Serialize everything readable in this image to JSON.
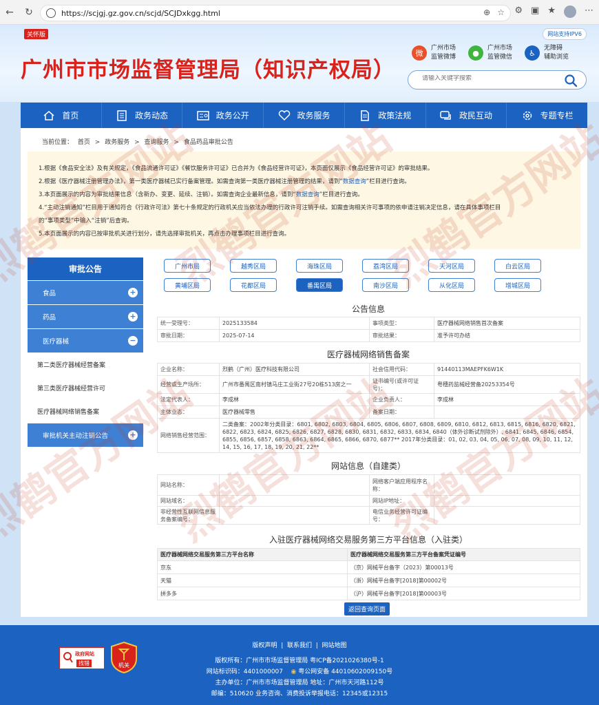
{
  "browser": {
    "url": "https://scjgj.gz.gov.cn/scjd/SCJDxkgg.html"
  },
  "header": {
    "care_badge": "关怀版",
    "title": "广州市市场监督管理局（知识产权局）",
    "ipv6": "网站支持IPV6",
    "quick_links": [
      {
        "line1": "广州市场",
        "line2": "监管微博",
        "icon": "weibo-icon",
        "color": "#e8512c"
      },
      {
        "line1": "广州市场",
        "line2": "监管微信",
        "icon": "wechat-icon",
        "color": "#3fb53f"
      },
      {
        "line1": "无障碍",
        "line2": "辅助浏览",
        "icon": "accessibility-icon",
        "color": "#1c62c0"
      }
    ],
    "search_placeholder": "请输入关键字搜索"
  },
  "nav": [
    {
      "label": "首页",
      "icon": "home-icon"
    },
    {
      "label": "政务动态",
      "icon": "news-icon"
    },
    {
      "label": "政务公开",
      "icon": "id-card-icon"
    },
    {
      "label": "政务服务",
      "icon": "heart-hand-icon"
    },
    {
      "label": "政策法规",
      "icon": "document-icon"
    },
    {
      "label": "政民互动",
      "icon": "chat-icon"
    },
    {
      "label": "专题专栏",
      "icon": "gear-icon"
    }
  ],
  "breadcrumb": {
    "prefix": "当前位置：",
    "items": [
      "首页",
      "政务服务",
      "查询服务",
      "食品药品审批公告"
    ],
    "sep": ">"
  },
  "notice": {
    "p1": "1.根据《食品安全法》及有关规定，《食品流通许可证》《餐饮服务许可证》已合并为《食品经营许可证》，本页面仅展示《食品经营许可证》的审批结果。",
    "p2a": "2.根据《医疗器械注册管理办法》，第一类医疗器械已实行备案管理。如需查询第一类医疗器械注册管理的结果，请到“",
    "p2link": "数据查询",
    "p2b": "”栏目进行查询。",
    "p3a": "3.本页面展示的内容为审批结果信息（含新办、变更、延续、注销）。如需查询企业最新信息，请到“",
    "p3link": "数据查询",
    "p3b": "”栏目进行查询。",
    "p4a": "4.“主动注销通知”栏目用于通知符合《行政许可法》第七十条规定的行政机关应当依法办理的行政许可注销手续。如需查询相关许可事项的依申请注销决定信息，请在具体事项栏目",
    "p4b": "的“事项类型”中输入“注销”后查询。",
    "p5": "5.本页面展示的内容已按审批机关进行划分，请先选择审批机关，再点击办理事项栏目进行查询。"
  },
  "sidebar": {
    "title": "审批公告",
    "items": [
      {
        "label": "食品",
        "toggle": "+"
      },
      {
        "label": "药品",
        "toggle": "+"
      },
      {
        "label": "医疗器械",
        "toggle": "−"
      }
    ],
    "subitems": [
      "第二类医疗器械经营备案",
      "第三类医疗器械经营许可",
      "医疗器械网络销售备案"
    ],
    "last": {
      "label": "审批机关主动注销公告",
      "toggle": "+"
    }
  },
  "districts": [
    "广州市局",
    "越秀区局",
    "海珠区局",
    "荔湾区局",
    "天河区局",
    "白云区局",
    "黄埔区局",
    "花都区局",
    "番禺区局",
    "南沙区局",
    "从化区局",
    "增城区局"
  ],
  "announce": {
    "title": "公告信息",
    "rows": [
      [
        "统一受理号：",
        "2025133584",
        "事项类型：",
        "医疗器械网络销售首次备案"
      ],
      [
        "审批日期：",
        "2025-07-14",
        "审批结果：",
        "准予许可办结"
      ]
    ]
  },
  "sales": {
    "title": "医疗器械网络销售备案",
    "company_k": "企业名称：",
    "company_v": "烈鹤（广州）医疗科技有限公司",
    "credit_k": "社会信用代码：",
    "credit_v": "91440113MAEPFK6W1K",
    "addr_k": "经营或生产场所：",
    "addr_v": "广州市番禺区南村镇马庄工业街27号20栋513房之一",
    "cert_k": "证书编号(或许可证号)：",
    "cert_v": "粤穗药监械经营备20253354号",
    "legal_k": "法定代表人：",
    "legal_v": "李成林",
    "head_k": "企业负责人：",
    "head_v": "李成林",
    "type_k": "主体业态：",
    "type_v": "医疗器械零售",
    "date_k": "备案日期：",
    "date_v": "",
    "scope_k": "网络销售经营范围：",
    "scope_v": "二类备案：2002年分类目录：6801, 6802, 6803, 6804, 6805, 6806, 6807, 6808, 6809, 6810, 6812, 6813, 6815, 6816, 6820, 6821, 6822, 6823, 6824, 6825, 6826, 6827, 6828, 6830, 6831, 6832, 6833, 6834, 6840（体外诊断试剂除外）, 6841, 6845, 6846, 6854, 6855, 6856, 6857, 6858, 6863, 6864, 6865, 6866, 6870, 6877** 2017年分类目录：01, 02, 03, 04, 05, 06, 07, 08, 09, 10, 11, 12, 14, 15, 16, 17, 18, 19, 20, 21, 22**"
  },
  "website": {
    "title": "网站信息（自建类）",
    "name_k": "网站名称：",
    "app_k": "网络客户端应用程序名称：",
    "domain_k": "网站域名：",
    "ip_k": "网站IP地址：",
    "nonprofit_k": "非经营性互联网信息服务备案编号：",
    "telecom_k": "电信业务经营许可证编号："
  },
  "platforms": {
    "title": "入驻医疗器械网络交易服务第三方平台信息（入驻类）",
    "col1": "医疗器械网络交易服务第三方平台名称",
    "col2": "医疗器械网络交易服务第三方平台备案凭证编号",
    "rows": [
      [
        "京东",
        "（京）网械平台备字（2023）第00013号"
      ],
      [
        "天猫",
        "（浙）网械平台备字[2018]第00002号"
      ],
      [
        "拼多多",
        "（沪）网械平台备字[2018]第00003号"
      ]
    ]
  },
  "back_button": "返回查询页面",
  "footer": {
    "links": [
      "版权声明",
      "联系我们",
      "网站地图"
    ],
    "line1": "版权所有：广州市市场监督管理局    粤ICP备2021026380号-1",
    "line2a": "网站标识码：4401000007",
    "line2b": "粤公网安备 44010602009150号",
    "line3": "主办单位：广州市市场监督管理局 地址：广州市天河路112号",
    "line4": "邮编：510620 业务咨询、消费投诉举报电话：12345或12315",
    "gov_badge_t1": "政府网站",
    "gov_badge_t2": "找错",
    "emblem_text": "机关"
  },
  "watermark": "烈鹤官方网站"
}
